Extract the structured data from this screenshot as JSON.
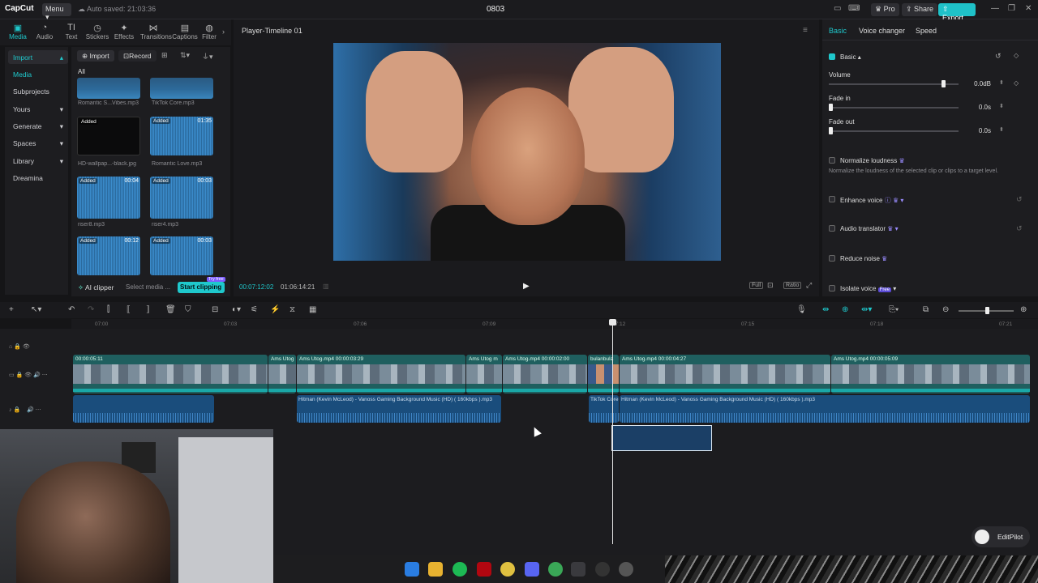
{
  "topbar": {
    "logo": "CapCut",
    "menu_label": "Menu",
    "autosave": "Auto saved: 21:03:36",
    "project_title": "0803",
    "pro_label": "Pro",
    "share_label": "Share",
    "export_label": "Export"
  },
  "tools": [
    {
      "label": "Media",
      "icon": "media-icon"
    },
    {
      "label": "Audio",
      "icon": "audio-icon"
    },
    {
      "label": "Text",
      "icon": "text-icon"
    },
    {
      "label": "Stickers",
      "icon": "stickers-icon"
    },
    {
      "label": "Effects",
      "icon": "effects-icon"
    },
    {
      "label": "Transitions",
      "icon": "transitions-icon"
    },
    {
      "label": "Captions",
      "icon": "captions-icon"
    },
    {
      "label": "Filter",
      "icon": "filter-icon"
    }
  ],
  "leftnav": {
    "import": "Import",
    "media": "Media",
    "subprojects": "Subprojects",
    "yours": "Yours",
    "generate": "Generate",
    "spaces": "Spaces",
    "library": "Library",
    "dreamina": "Dreamina"
  },
  "media": {
    "import_btn": "Import",
    "record_btn": "Record",
    "all_label": "All",
    "items": [
      {
        "name": "Romantic S...Vibes.mp3",
        "added": "",
        "duration": ""
      },
      {
        "name": "TikTok Core.mp3",
        "added": "",
        "duration": ""
      },
      {
        "name": "HD-wallpap...-black.jpg",
        "added": "Added",
        "duration": ""
      },
      {
        "name": "Romantic Love.mp3",
        "added": "Added",
        "duration": "01:35"
      },
      {
        "name": "riser8.mp3",
        "added": "Added",
        "duration": "00:04"
      },
      {
        "name": "riser4.mp3",
        "added": "Added",
        "duration": "00:03"
      },
      {
        "name": "",
        "added": "Added",
        "duration": "00:12"
      },
      {
        "name": "",
        "added": "Added",
        "duration": "00:03"
      }
    ],
    "ai_clipper": "AI clipper",
    "select_media": "Select media ...",
    "start_clipping": "Start clipping",
    "try_free": "Try free"
  },
  "player": {
    "title": "Player-Timeline 01",
    "time_current": "00:07:12:02",
    "time_total": "01:06:14:21",
    "full": "Full",
    "ratio": "Ratio"
  },
  "rpanel": {
    "tabs": [
      "Basic",
      "Voice changer",
      "Speed"
    ],
    "basic_section": "Basic",
    "volume_label": "Volume",
    "volume_value": "0.0dB",
    "volume_level": 0.88,
    "fadein_label": "Fade in",
    "fadein_value": "0.0s",
    "fadeout_label": "Fade out",
    "fadeout_value": "0.0s",
    "normalize_label": "Normalize loudness",
    "normalize_desc": "Normalize the loudness of the selected clip or clips to a target level.",
    "enhance_label": "Enhance voice",
    "translator_label": "Audio translator",
    "reduce_label": "Reduce noise",
    "isolate_label": "Isolate voice",
    "free_badge": "Free"
  },
  "ruler": [
    "07:00",
    "07:03",
    "07:06",
    "07:09",
    "07:12",
    "07:15",
    "07:18",
    "07:21"
  ],
  "video_clips": [
    {
      "label": "00:00:05:11"
    },
    {
      "label": "Ams Utog"
    },
    {
      "label": "Ams Utog.mp4  00:00:03:29"
    },
    {
      "label": "Ams Utog m"
    },
    {
      "label": "Ams Utog.mp4  00:00:02:00"
    },
    {
      "label": "bulanbula"
    },
    {
      "label": "Ams Utog.mp4  00:00:04:27"
    },
    {
      "label": "Ams Utog.mp4  00:00:05:09"
    }
  ],
  "audio_clips": [
    {
      "label": ""
    },
    {
      "label": "Hitman (Kevin McLeod) - Vanoss Gaming Background Music (HD) ( 160kbps ).mp3"
    },
    {
      "label": "TikTok Core"
    },
    {
      "label": "Hitman (Kevin McLeod) - Vanoss Gaming Background Music (HD) ( 160kbps ).mp3"
    }
  ],
  "editpilot": "EditPilot"
}
